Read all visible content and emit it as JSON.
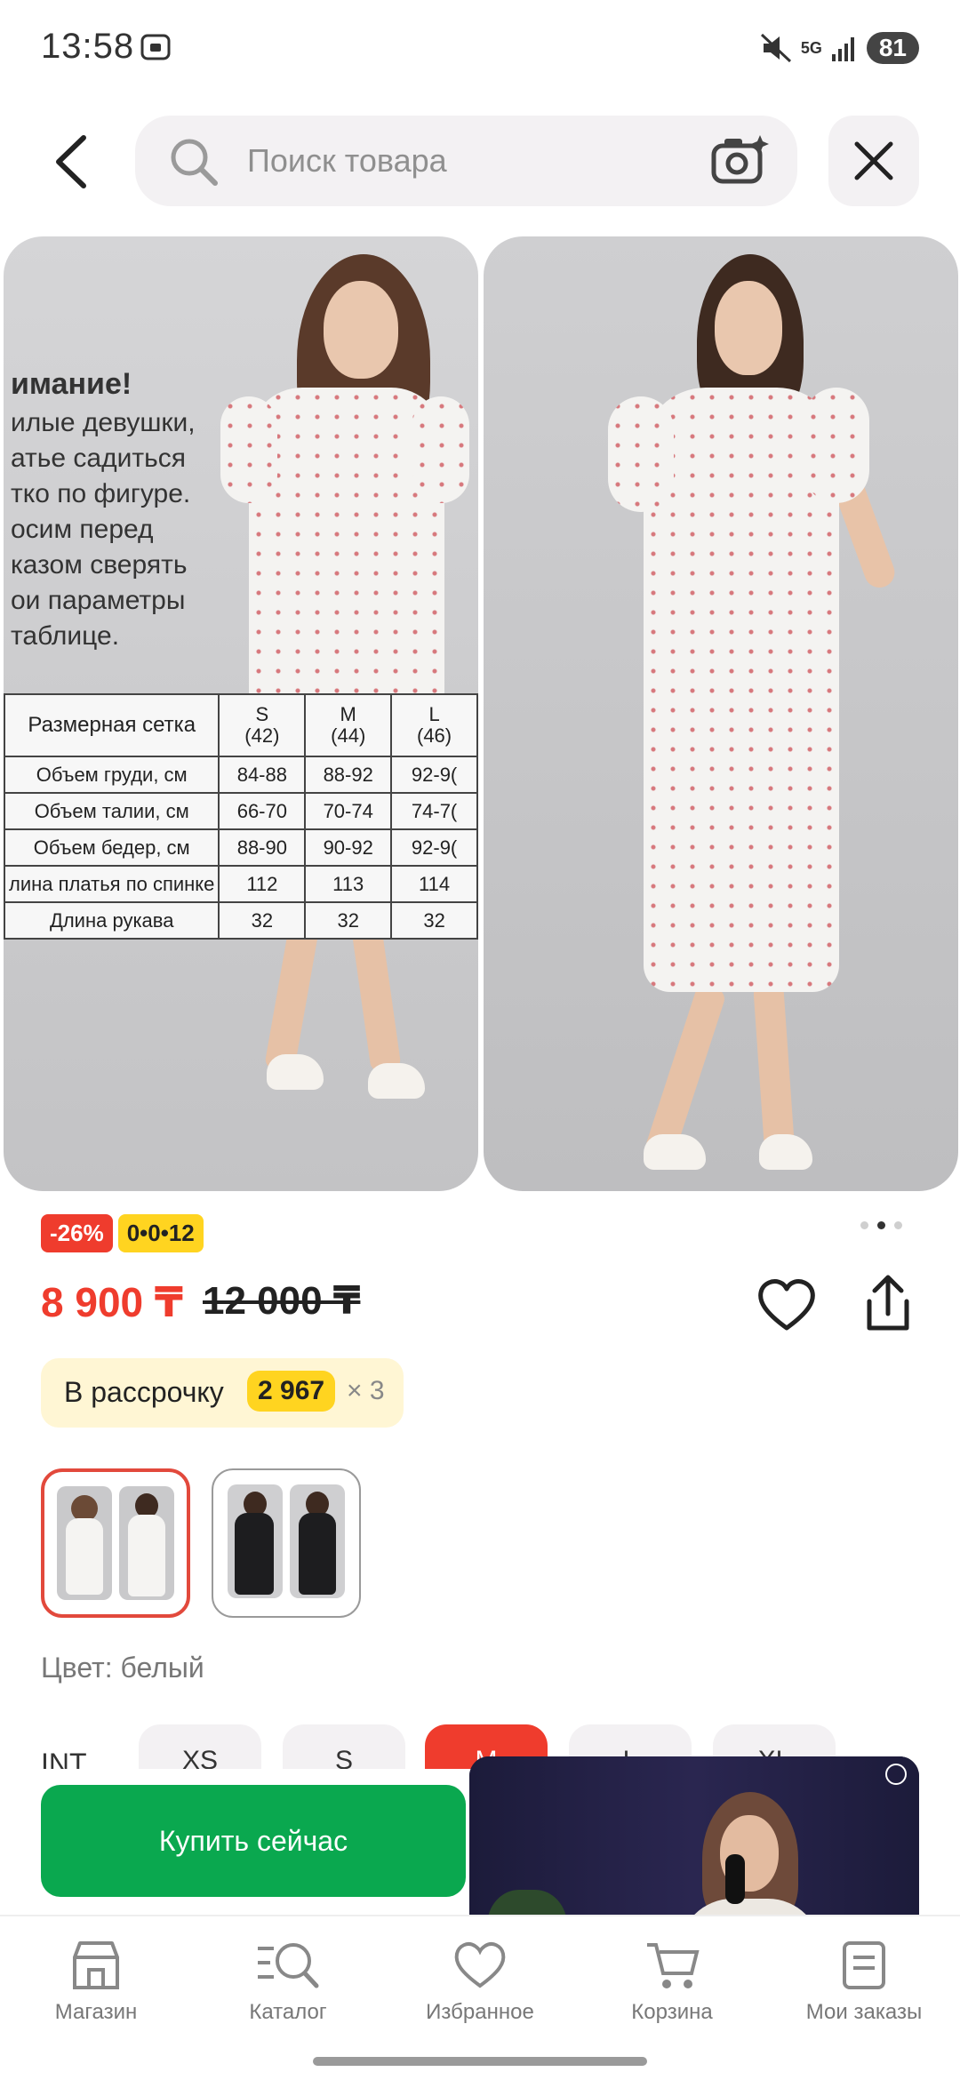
{
  "status_bar": {
    "time": "13:58",
    "network": "5G",
    "battery": "81"
  },
  "header": {
    "search_placeholder": "Поиск товара"
  },
  "gallery": {
    "warning": {
      "title": "имание!",
      "lines": [
        "илые девушки,",
        "атье садиться",
        "тко по фигуре.",
        "осим перед",
        "казом сверять",
        "ои параметры",
        "таблице."
      ]
    },
    "size_table": {
      "header_label": "Размерная сетка",
      "sizes": [
        {
          "name": "S",
          "code": "(42)"
        },
        {
          "name": "M",
          "code": "(44)"
        },
        {
          "name": "L",
          "code": "(46)"
        }
      ],
      "rows": [
        {
          "label": "Объем груди, см",
          "values": [
            "84-88",
            "88-92",
            "92-9("
          ]
        },
        {
          "label": "Объем талии, см",
          "values": [
            "66-70",
            "70-74",
            "74-7("
          ]
        },
        {
          "label": "Объем бедер, см",
          "values": [
            "88-90",
            "90-92",
            "92-9("
          ]
        },
        {
          "label": "лина платья по спинке",
          "values": [
            "112",
            "113",
            "114"
          ]
        },
        {
          "label": "Длина рукава",
          "values": [
            "32",
            "32",
            "32"
          ]
        }
      ]
    },
    "pages_total": 3,
    "page_active": 2
  },
  "badges": {
    "discount": "-26%",
    "timer": "0•0•12"
  },
  "price": {
    "current": "8 900 ₸",
    "old": "12 000 ₸"
  },
  "installment": {
    "label": "В рассрочку",
    "amount": "2 967",
    "times": "× 3"
  },
  "color": {
    "label": "Цвет: белый"
  },
  "sizes": {
    "label": "INT",
    "options": [
      "XS",
      "S",
      "M",
      "L",
      "XL"
    ],
    "selected": "M"
  },
  "buy_button": {
    "label": "Купить сейчас"
  },
  "bottom_nav": {
    "items": [
      {
        "label": "Магазин",
        "icon": "shop-icon"
      },
      {
        "label": "Каталог",
        "icon": "catalog-icon"
      },
      {
        "label": "Избранное",
        "icon": "heart-icon"
      },
      {
        "label": "Корзина",
        "icon": "cart-icon"
      },
      {
        "label": "Мои заказы",
        "icon": "orders-icon"
      }
    ]
  },
  "colors": {
    "accent_red": "#ef3c2d",
    "buy_green": "#0aa84f",
    "badge_yellow": "#ffd420"
  }
}
